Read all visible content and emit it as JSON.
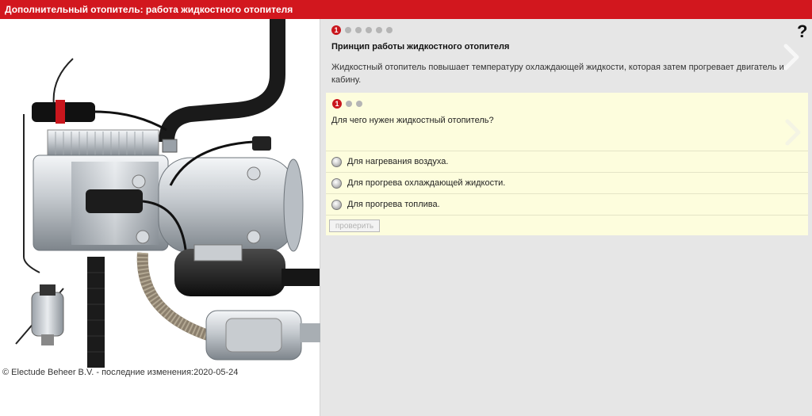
{
  "window": {
    "title": "Дополнительный отопитель: работа жидкостного отопителя"
  },
  "lesson": {
    "step_number": "1",
    "step_count": 6,
    "heading": "Принцип работы жидкостного отопителя",
    "description": "Жидкостный отопитель повышает температуру охлаждающей жидкости, которая затем прогревает двигатель и кабину."
  },
  "help": {
    "label": "?"
  },
  "quiz": {
    "step_number": "1",
    "step_count": 3,
    "question": "Для чего нужен жидкостный отопитель?",
    "options": [
      {
        "label": "Для нагревания воздуха."
      },
      {
        "label": "Для прогрева охлаждающей жидкости."
      },
      {
        "label": "Для прогрева топлива."
      }
    ],
    "check_label": "проверить"
  },
  "image": {
    "copyright": "© Electude Beheer B.V. - последние изменения:2020-05-24"
  },
  "colors": {
    "accent": "#d2171e",
    "panel": "#fdfddd",
    "background": "#e6e6e6"
  }
}
